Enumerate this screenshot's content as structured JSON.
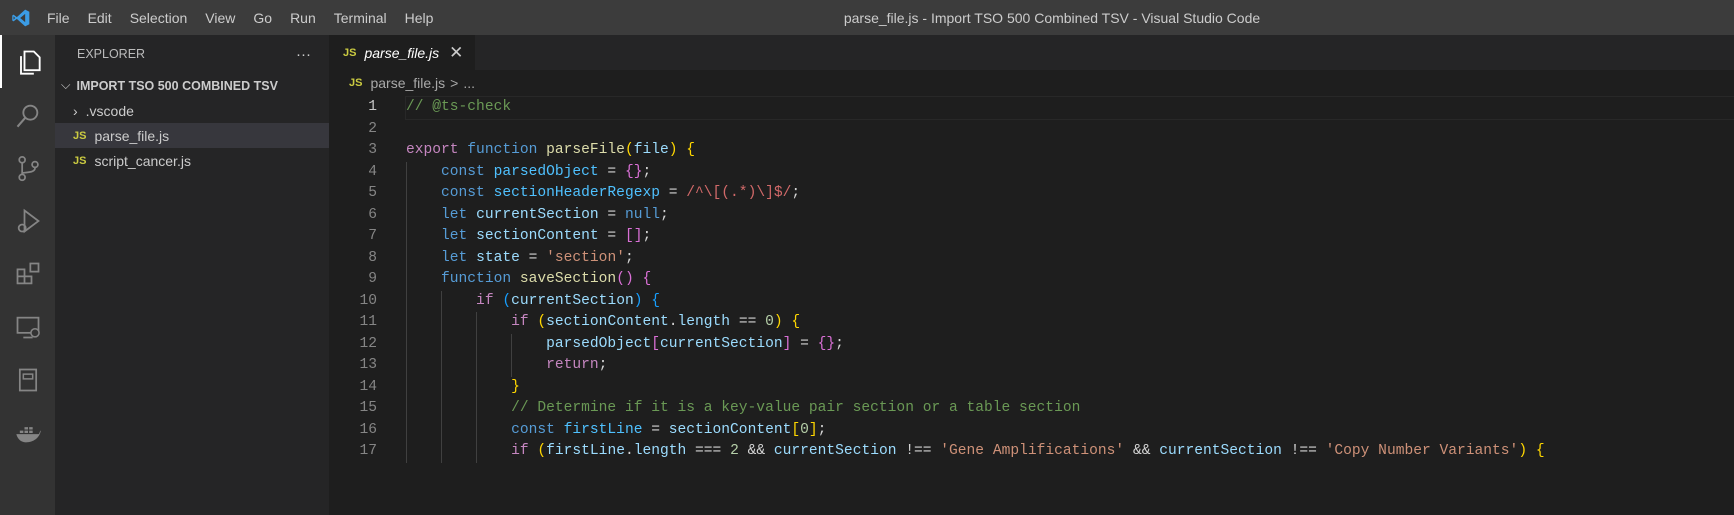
{
  "window_title": "parse_file.js - Import TSO 500 Combined TSV - Visual Studio Code",
  "menu": [
    "File",
    "Edit",
    "Selection",
    "View",
    "Go",
    "Run",
    "Terminal",
    "Help"
  ],
  "activity": [
    "explorer-icon",
    "search-icon",
    "source-control-icon",
    "run-debug-icon",
    "extensions-icon",
    "remote-explorer-icon",
    "notebook-icon",
    "docker-icon"
  ],
  "sidebar": {
    "title": "EXPLORER",
    "more": "···",
    "folder": "IMPORT TSO 500 COMBINED TSV",
    "items": [
      {
        "label": ".vscode",
        "type": "folder"
      },
      {
        "label": "parse_file.js",
        "type": "js",
        "selected": true
      },
      {
        "label": "script_cancer.js",
        "type": "js"
      }
    ]
  },
  "editor": {
    "tab": {
      "icon": "JS",
      "label": "parse_file.js",
      "close": "✕"
    },
    "breadcrumb": {
      "icon": "JS",
      "file": "parse_file.js",
      "sep": ">",
      "rest": "..."
    },
    "lines": [
      [
        [
          "// @ts-check",
          "c"
        ]
      ],
      [],
      [
        [
          "export",
          "kc"
        ],
        [
          " function ",
          "kw"
        ],
        [
          "parseFile",
          "f"
        ],
        [
          "(",
          "b1"
        ],
        [
          "file",
          "v"
        ],
        [
          ")",
          "b1"
        ],
        [
          " ",
          "p"
        ],
        [
          "{",
          "b1"
        ]
      ],
      [
        [
          "    const ",
          "kw"
        ],
        [
          "parsedObject",
          "cn"
        ],
        [
          " = ",
          "p"
        ],
        [
          "{}",
          "b2"
        ],
        [
          ";",
          "p"
        ]
      ],
      [
        [
          "    const ",
          "kw"
        ],
        [
          "sectionHeaderRegexp",
          "cn"
        ],
        [
          " = ",
          "p"
        ],
        [
          "/^\\[(.*)\\]$/",
          "re"
        ],
        [
          ";",
          "p"
        ]
      ],
      [
        [
          "    let ",
          "kw"
        ],
        [
          "currentSection",
          "v"
        ],
        [
          " = ",
          "p"
        ],
        [
          "null",
          "kw"
        ],
        [
          ";",
          "p"
        ]
      ],
      [
        [
          "    let ",
          "kw"
        ],
        [
          "sectionContent",
          "v"
        ],
        [
          " = ",
          "p"
        ],
        [
          "[]",
          "b2"
        ],
        [
          ";",
          "p"
        ]
      ],
      [
        [
          "    let ",
          "kw"
        ],
        [
          "state",
          "v"
        ],
        [
          " = ",
          "p"
        ],
        [
          "'section'",
          "s"
        ],
        [
          ";",
          "p"
        ]
      ],
      [
        [
          "    function ",
          "kw"
        ],
        [
          "saveSection",
          "f"
        ],
        [
          "()",
          "b2"
        ],
        [
          " ",
          "p"
        ],
        [
          "{",
          "b2"
        ]
      ],
      [
        [
          "        if ",
          "kc"
        ],
        [
          "(",
          "b3"
        ],
        [
          "currentSection",
          "v"
        ],
        [
          ")",
          "b3"
        ],
        [
          " ",
          "p"
        ],
        [
          "{",
          "b3"
        ]
      ],
      [
        [
          "            if ",
          "kc"
        ],
        [
          "(",
          "b1"
        ],
        [
          "sectionContent",
          "v"
        ],
        [
          ".",
          "p"
        ],
        [
          "length",
          "v"
        ],
        [
          " == ",
          "p"
        ],
        [
          "0",
          "n"
        ],
        [
          ")",
          "b1"
        ],
        [
          " ",
          "p"
        ],
        [
          "{",
          "b1"
        ]
      ],
      [
        [
          "                parsedObject",
          "v"
        ],
        [
          "[",
          "b2"
        ],
        [
          "currentSection",
          "v"
        ],
        [
          "]",
          "b2"
        ],
        [
          " = ",
          "p"
        ],
        [
          "{}",
          "b2"
        ],
        [
          ";",
          "p"
        ]
      ],
      [
        [
          "                return",
          "kc"
        ],
        [
          ";",
          "p"
        ]
      ],
      [
        [
          "            }",
          "b1"
        ]
      ],
      [
        [
          "            // Determine if it is a key-value pair section or a table section",
          "c"
        ]
      ],
      [
        [
          "            const ",
          "kw"
        ],
        [
          "firstLine",
          "cn"
        ],
        [
          " = ",
          "p"
        ],
        [
          "sectionContent",
          "v"
        ],
        [
          "[",
          "b1"
        ],
        [
          "0",
          "n"
        ],
        [
          "]",
          "b1"
        ],
        [
          ";",
          "p"
        ]
      ],
      [
        [
          "            if ",
          "kc"
        ],
        [
          "(",
          "b1"
        ],
        [
          "firstLine",
          "v"
        ],
        [
          ".",
          "p"
        ],
        [
          "length",
          "v"
        ],
        [
          " === ",
          "p"
        ],
        [
          "2",
          "n"
        ],
        [
          " && ",
          "p"
        ],
        [
          "currentSection",
          "v"
        ],
        [
          " !== ",
          "p"
        ],
        [
          "'Gene Amplifications'",
          "s"
        ],
        [
          " && ",
          "p"
        ],
        [
          "currentSection",
          "v"
        ],
        [
          " !== ",
          "p"
        ],
        [
          "'Copy Number Variants'",
          "s"
        ],
        [
          ")",
          "b1"
        ],
        [
          " ",
          "p"
        ],
        [
          "{",
          "b1"
        ]
      ]
    ]
  }
}
